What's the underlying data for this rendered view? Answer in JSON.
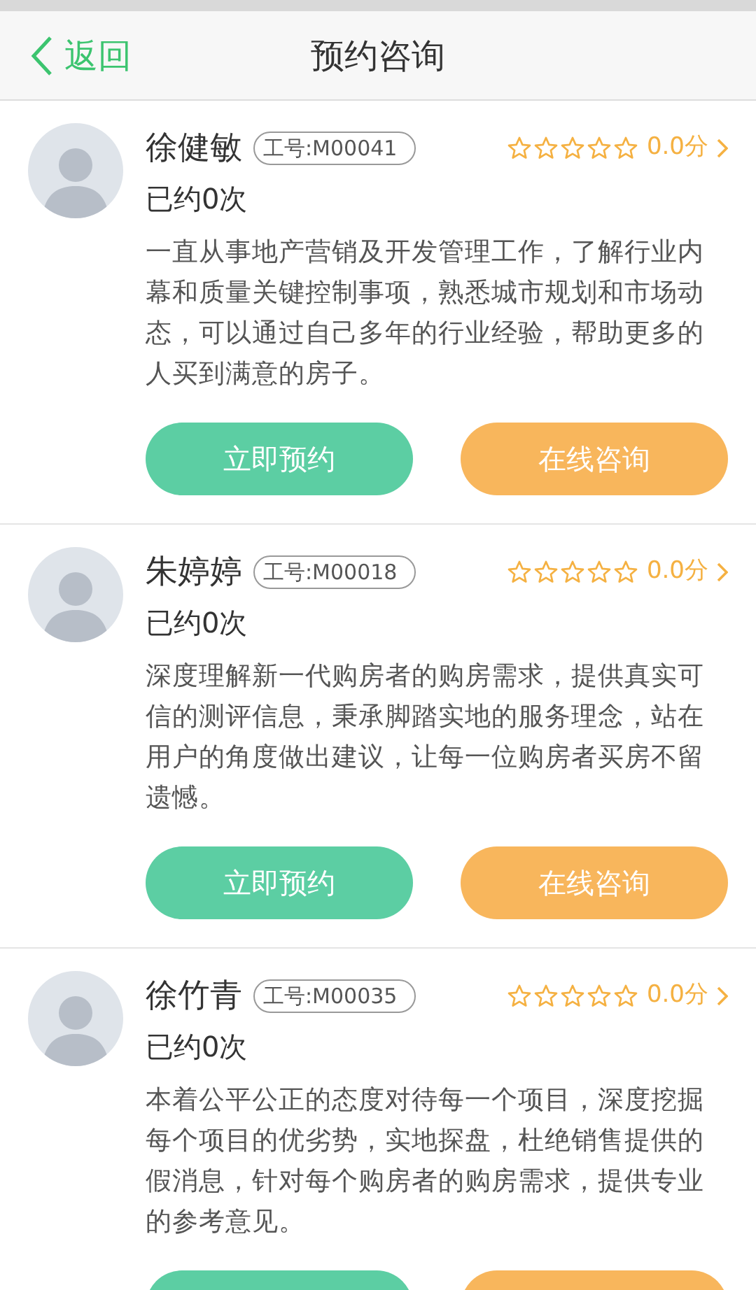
{
  "header": {
    "back_label": "返回",
    "title": "预约咨询"
  },
  "advisors": [
    {
      "name": "徐健敏",
      "employee_id": "工号:M00041",
      "stars": 0,
      "score": "0.0分",
      "bookings": "已约0次",
      "bio": "一直从事地产营销及开发管理工作，了解行业内幕和质量关键控制事项，熟悉城市规划和市场动态，可以通过自己多年的行业经验，帮助更多的人买到满意的房子。",
      "actions": [
        {
          "kind": "book",
          "label": "立即预约"
        },
        {
          "kind": "chat",
          "label": "在线咨询"
        }
      ]
    },
    {
      "name": "朱婷婷",
      "employee_id": "工号:M00018",
      "stars": 0,
      "score": "0.0分",
      "bookings": "已约0次",
      "bio": "深度理解新一代购房者的购房需求，提供真实可信的测评信息，秉承脚踏实地的服务理念，站在用户的角度做出建议，让每一位购房者买房不留遗憾。",
      "actions": [
        {
          "kind": "book",
          "label": "立即预约"
        },
        {
          "kind": "chat",
          "label": "在线咨询"
        }
      ]
    },
    {
      "name": "徐竹青",
      "employee_id": "工号:M00035",
      "stars": 0,
      "score": "0.0分",
      "bookings": "已约0次",
      "bio": "本着公平公正的态度对待每一个项目，深度挖掘每个项目的优劣势，实地探盘，杜绝销售提供的假消息，针对每个购房者的购房需求，提供专业的参考意见。",
      "actions": [
        {
          "kind": "book"
        },
        {
          "kind": "chat"
        }
      ]
    }
  ]
}
